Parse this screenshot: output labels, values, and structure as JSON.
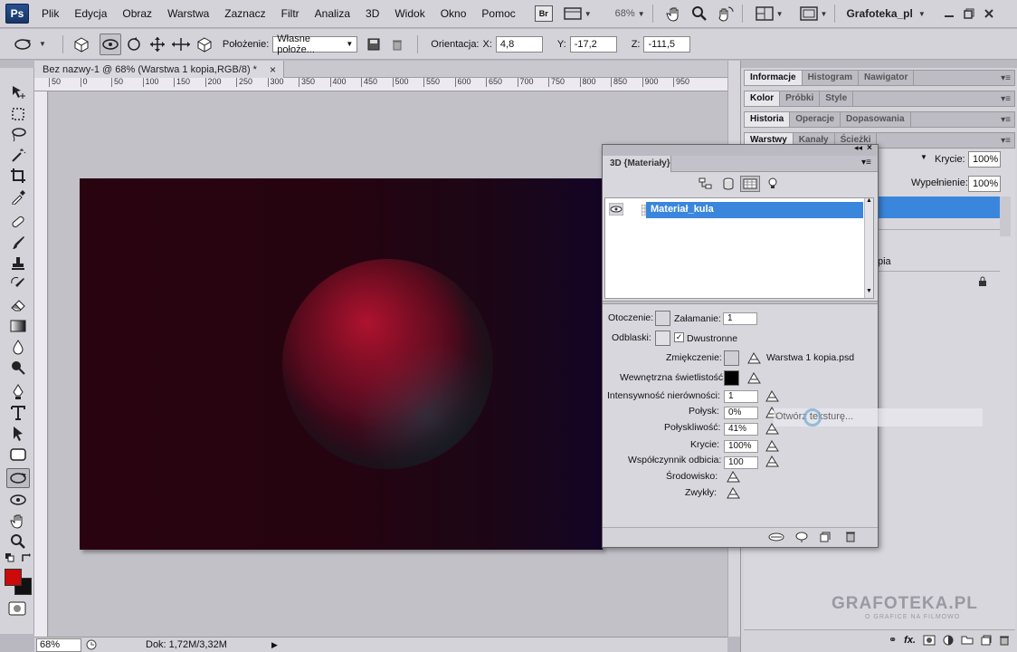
{
  "app": {
    "logo": "Ps"
  },
  "menu": {
    "items": [
      "Plik",
      "Edycja",
      "Obraz",
      "Warstwa",
      "Zaznacz",
      "Filtr",
      "Analiza",
      "3D",
      "Widok",
      "Okno",
      "Pomoc"
    ]
  },
  "menubar": {
    "bridge": "Br",
    "zoom": "68%",
    "workspace": "Grafoteka_pl"
  },
  "options": {
    "position_label": "Położenie:",
    "position_value": "Własne położe...",
    "orientation_label": "Orientacja:",
    "x_label": "X:",
    "x_value": "4,8",
    "y_label": "Y:",
    "y_value": "-17,2",
    "z_label": "Z:",
    "z_value": "-111,5"
  },
  "document": {
    "tab_title": "Bez nazwy-1 @ 68% (Warstwa 1 kopia,RGB/8) *",
    "close": "×"
  },
  "ruler": {
    "h_labels": [
      "50",
      "0",
      "50",
      "100",
      "150",
      "200",
      "250",
      "300",
      "350",
      "400",
      "450",
      "500",
      "550",
      "600",
      "650",
      "700",
      "750",
      "800",
      "850",
      "900",
      "950"
    ]
  },
  "status": {
    "zoom": "68%",
    "doc_size": "Dok: 1,72M/3,32M"
  },
  "panels": {
    "group1": [
      "Informacje",
      "Histogram",
      "Nawigator"
    ],
    "group2": [
      "Kolor",
      "Próbki",
      "Style"
    ],
    "group3": [
      "Historia",
      "Operacje",
      "Dopasowania"
    ],
    "group4": [
      "Warstwy",
      "Kanały",
      "Ścieżki"
    ],
    "layers_opacity_label": "Krycie:",
    "layers_opacity_value": "100%",
    "layers_fill_label": "Wypełnienie:",
    "layers_fill_value": "100%",
    "layer_partial_text": "pia"
  },
  "panel3d": {
    "tab": "3D {Materiały}",
    "material_name": "Materiał_kula",
    "props": {
      "otoczenie": "Otoczenie:",
      "zalamanie_label": "Załamanie:",
      "zalamanie_value": "1",
      "odblaski": "Odblaski:",
      "dwustronne": "Dwustronne",
      "zmiekczenie": "Zmiękczenie:",
      "zmiekczenie_file": "Warstwa 1 kopia.psd",
      "swietlistosc": "Wewnętrzna świetlistość:",
      "nierownosci_label": "Intensywność nierówności:",
      "nierownosci_value": "1",
      "polysk_label": "Połysk:",
      "polysk_value": "0%",
      "polyskliwosc_label": "Połyskliwość:",
      "polyskliwosc_value": "41%",
      "krycie_label": "Krycie:",
      "krycie_value": "100%",
      "odbicie_label": "Współczynnik odbicia:",
      "odbicie_value": "100",
      "srodowisko": "Środowisko:",
      "zwykly": "Zwykły:"
    },
    "tooltip": "Otwórz teksturę..."
  },
  "colors": {
    "foreground": "#cc0a0a",
    "background": "#111111",
    "selection": "#3b86dd"
  },
  "watermark": {
    "brand": "GRAFOTEKA.PL",
    "tagline": "O GRAFICE NA FILMOWO"
  }
}
